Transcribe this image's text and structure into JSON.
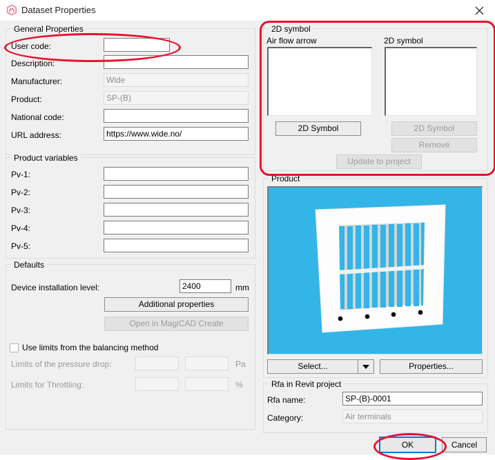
{
  "window": {
    "title": "Dataset Properties",
    "icon": "magicad-hexagon-icon",
    "close_label": "✕",
    "accent_red": "#e8112d",
    "focus_blue": "#0078d7",
    "dialog_bg": "#f0f0f0"
  },
  "general": {
    "group_title": "General Properties",
    "fields": [
      {
        "label": "User code:",
        "value": "",
        "disabled": false
      },
      {
        "label": "Description:",
        "value": "",
        "disabled": false
      },
      {
        "label": "Manufacturer:",
        "value": "Wide",
        "disabled": true
      },
      {
        "label": "Product:",
        "value": "SP-(B)",
        "disabled": true
      },
      {
        "label": "National code:",
        "value": "",
        "disabled": false
      },
      {
        "label": "URL address:",
        "value": "https://www.wide.no/",
        "disabled": false
      }
    ]
  },
  "product_variables": {
    "group_title": "Product variables",
    "fields": [
      {
        "label": "Pv-1:",
        "value": ""
      },
      {
        "label": "Pv-2:",
        "value": ""
      },
      {
        "label": "Pv-3:",
        "value": ""
      },
      {
        "label": "Pv-4:",
        "value": ""
      },
      {
        "label": "Pv-5:",
        "value": ""
      }
    ]
  },
  "defaults": {
    "group_title": "Defaults",
    "device_level_label": "Device installation level:",
    "device_level_value": "2400",
    "device_level_unit": "mm",
    "additional_properties_button": "Additional properties",
    "open_magicad_button": "Open in MagiCAD Create",
    "use_limits_label": "Use limits from the balancing method",
    "use_limits_checked": false,
    "pressure_drop_label": "Limits of the pressure drop:",
    "pressure_drop_min": "",
    "pressure_drop_max": "",
    "pressure_drop_unit": "Pa",
    "throttling_label": "Limits for Throttling:",
    "throttling_min": "",
    "throttling_max": "",
    "throttling_unit": "%"
  },
  "symbol2d": {
    "group_title": "2D symbol",
    "air_flow_arrow_label": "Air flow arrow",
    "symbol_label": "2D symbol",
    "air_flow_preview": "",
    "symbol_preview": "",
    "air_flow_button": "2D Symbol",
    "symbol_button": "2D Symbol",
    "remove_button": "Remove",
    "update_button": "Update to project"
  },
  "product": {
    "group_title": "Product",
    "image_alt": "air-terminal-grille-preview",
    "image_bg_color": "#33b5e8",
    "select_button": "Select...",
    "properties_button": "Properties..."
  },
  "rfa": {
    "group_title": "Rfa in Revit project",
    "name_label": "Rfa name:",
    "name_value": "SP-(B)-0001",
    "category_label": "Category:",
    "category_value": "Air terminals"
  },
  "footer": {
    "ok_label": "OK",
    "cancel_label": "Cancel"
  }
}
